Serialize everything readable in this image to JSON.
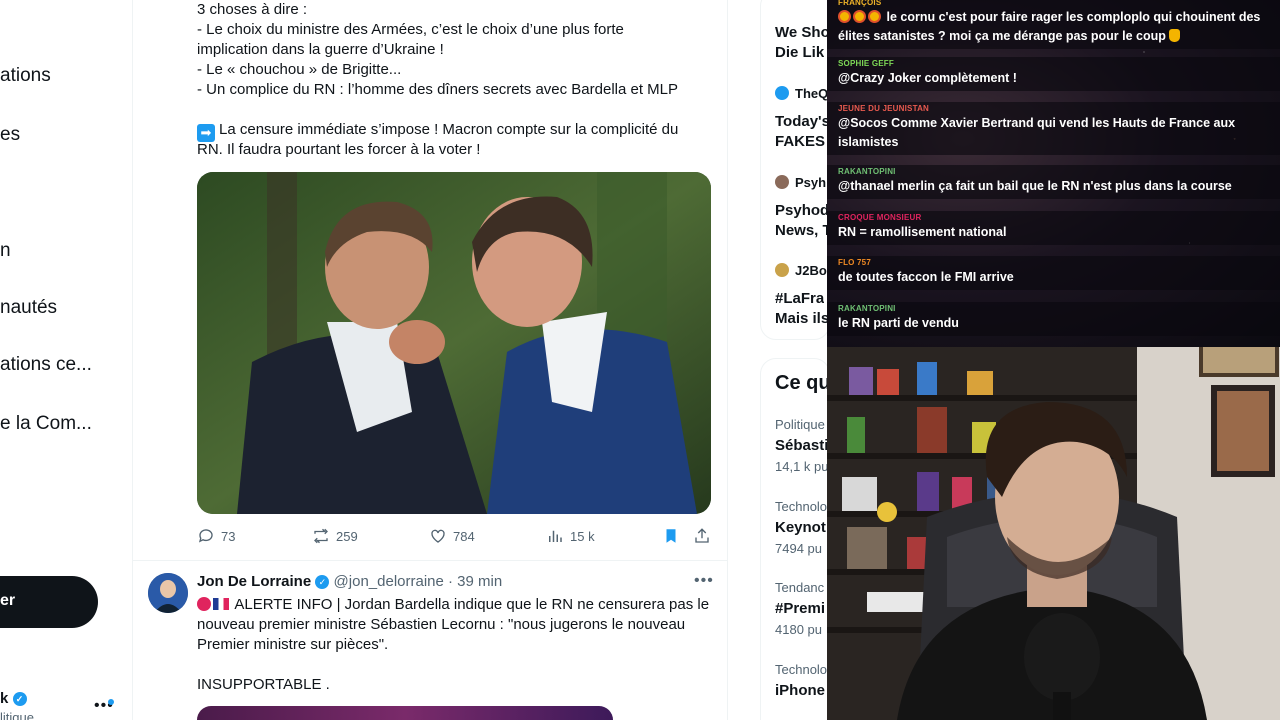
{
  "nav": {
    "items": [
      "ations",
      "es",
      "n",
      "nautés",
      "ations ce...",
      "e la Com..."
    ],
    "post_label": "er",
    "account_name": "k",
    "account_sub": "litique"
  },
  "tweet1": {
    "lines": [
      "3 choses à dire :",
      "- Le choix du ministre des Armées, c’est le choix d’une plus forte",
      "implication dans la guerre d’Ukraine !",
      "- Le « chouchou » de Brigitte...",
      "- Un complice du RN : l’homme des dîners secrets avec Bardella et MLP"
    ],
    "para2_line1": "La censure immédiate s’impose ! Macron compte sur la complicité du",
    "para2_line2": "RN. Il faudra pourtant les forcer à la voter !",
    "replies": "73",
    "reposts": "259",
    "likes": "784",
    "views": "15 k"
  },
  "tweet2": {
    "name": "Jon De Lorraine",
    "handle": "@jon_delorraine",
    "time": "· 39 min",
    "line1": "ALERTE INFO | Jordan Bardella indique que le RN ne censurera pas le",
    "line2": "nouveau premier ministre Sébastien Lecornu : \"nous jugerons le nouveau",
    "line3": "Premier ministre sur pièces\".",
    "line4": "INSUPPORTABLE ."
  },
  "sidebar": {
    "top1": "We Sho",
    "top2": "Die Lik",
    "items": [
      {
        "author": "TheQ",
        "line1": "Today's",
        "line2": "FAKES"
      },
      {
        "author": "Psyh",
        "line1": "Psyhod",
        "line2": "News, T"
      },
      {
        "author": "J2Bo",
        "line1": "#LaFra",
        "line2": "Mais ils"
      }
    ],
    "section_title": "Ce qu",
    "trends": [
      {
        "category": "Politique",
        "title": "Sébasti",
        "count": "14,1 k pu"
      },
      {
        "category": "Technolo",
        "title": "Keynot",
        "count": "7494 pu"
      },
      {
        "category": "Tendanc",
        "title": "#Premi",
        "count": "4180 pu"
      },
      {
        "category": "Technolo",
        "title": "iPhone",
        "count": ""
      }
    ]
  },
  "chat": {
    "messages": [
      {
        "user": "FRANÇOIS",
        "color": "#f0b429",
        "text_line1": "le cornu c'est pour faire rager les comploplo qui chouinent des",
        "text_line2": "élites satanistes ? moi ça me dérange pas pour le coup"
      },
      {
        "user": "SOPHIE GEFF",
        "color": "#7ed957",
        "text_line1": "@Crazy Joker complètement !",
        "text_line2": ""
      },
      {
        "user": "JEUNE DU JEUNISTAN",
        "color": "#e85a4f",
        "text_line1": "@Socos Comme Xavier Bertrand qui vend les Hauts de France aux",
        "text_line2": "islamistes"
      },
      {
        "user": "RAKANTOPINI",
        "color": "#6fbf73",
        "text_line1": "@thanael merlin ça fait un bail que le RN n'est plus dans la course",
        "text_line2": ""
      },
      {
        "user": "CROQUE MONSIEUR",
        "color": "#e0245e",
        "text_line1": "RN = ramollisement national",
        "text_line2": ""
      },
      {
        "user": "FLO 757",
        "color": "#f08a24",
        "text_line1": "de toutes faccon le FMI arrive",
        "text_line2": ""
      },
      {
        "user": "RAKANTOPINI",
        "color": "#6fbf73",
        "text_line1": "le RN parti de vendu",
        "text_line2": ""
      }
    ]
  }
}
